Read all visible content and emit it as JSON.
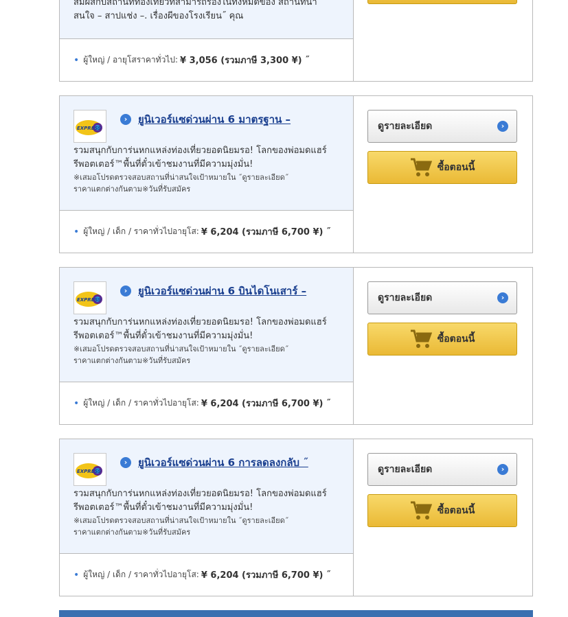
{
  "top_card": {
    "desc_line1": "สัมผัสกับสถานที่ท่องเที่ยวที่สามารถรองในทั้งหมดของ  สถานที่น่า",
    "desc_line2": "สนใจ – สาปแช่ง –. เรื่องผีของโรงเรียน˝ คุณ",
    "price_label": "ผู้ใหญ่ / อายุโสราคาทั่วไป:",
    "price_value": "¥ 3,056 (รวมภาษี 3,300 ¥) ˝"
  },
  "cards": [
    {
      "title": "ยูนิเวอร์แซด่วนผ่าน 6 มาตรฐาน –",
      "desc_line1": "รวมสนุกกับการ่นหกแหล่งท่องเที่ยวยอดนิยมรอ! โลกของพ่อมดแฮร์",
      "desc_line2": "รีพอตเตอร์™พื้นที่ตั๋วเข้าชมงานที่มีความมุ่งมั่น!",
      "note_line1": "※เสมอโปรดตรวจสอบสถานที่น่าสนใจเป้าหมายใน ˝ดูรายละเอียด˝",
      "note_line2": "ราคาแตกต่างกันตาม※วันที่รับสมัคร",
      "price_label": "ผู้ใหญ่ / เด็ก / ราคาทั่วไปอายุโส:",
      "price_value": "¥ 6,204 (รวมภาษี 6,700 ¥) ˝",
      "detail_label": "ดูรายละเอียด",
      "buy_label": "ซื้อตอนนี้"
    },
    {
      "title": "ยูนิเวอร์แซด่วนผ่าน 6 บินไดโนเสาร์ –",
      "desc_line1": "รวมสนุกกับการ่นหกแหล่งท่องเที่ยวยอดนิยมรอ! โลกของพ่อมดแฮร์",
      "desc_line2": "รีพอตเตอร์™พื้นที่ตั๋วเข้าชมงานที่มีความมุ่งมั่น!",
      "note_line1": "※เสมอโปรดตรวจสอบสถานที่น่าสนใจเป้าหมายใน ˝ดูรายละเอียด˝",
      "note_line2": "ราคาแตกต่างกันตาม※วันที่รับสมัคร",
      "price_label": "ผู้ใหญ่ / เด็ก / ราคาทั่วไปอายุโส:",
      "price_value": "¥ 6,204 (รวมภาษี 6,700 ¥) ˝",
      "detail_label": "ดูรายละเอียด",
      "buy_label": "ซื้อตอนนี้"
    },
    {
      "title": "ยูนิเวอร์แซด่วนผ่าน 6 การลดลงกลับ ˝",
      "desc_line1": "รวมสนุกกับการ่นหกแหล่งท่องเที่ยวยอดนิยมรอ! โลกของพ่อมดแฮร์",
      "desc_line2": "รีพอตเตอร์™พื้นที่ตั๋วเข้าชมงานที่มีความมุ่งมั่น!",
      "note_line1": "※เสมอโปรดตรวจสอบสถานที่น่าสนใจเป้าหมายใน ˝ดูรายละเอียด˝",
      "note_line2": "ราคาแตกต่างกันตาม※วันที่รับสมัคร",
      "price_label": "ผู้ใหญ่ / เด็ก / ราคาทั่วไปอายุโส:",
      "price_value": "¥ 6,204 (รวมภาษี 6,700 ¥) ˝",
      "detail_label": "ดูรายละเอียด",
      "buy_label": "ซื้อตอนนี้"
    }
  ],
  "logo_text": "EXPRESS",
  "icons": {
    "title_arrow": "chevron-right-circle-icon",
    "detail_arrow": "chevron-right-circle-icon",
    "cart": "shopping-cart-icon",
    "logo": "express-pass-logo"
  },
  "colors": {
    "accent_blue": "#3a7bd5",
    "link_blue": "#1a3f8f",
    "panel_bg": "#eef4fd",
    "buy_yellow": "#f0c94a",
    "footer_bar": "#3a6fb0"
  }
}
